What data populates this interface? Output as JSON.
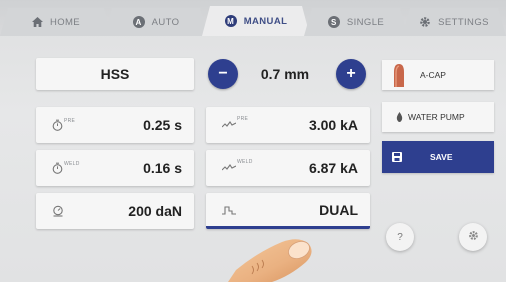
{
  "tabs": [
    {
      "label": "HOME",
      "icon": "home-icon",
      "active": false
    },
    {
      "label": "AUTO",
      "icon": "auto-icon",
      "active": false
    },
    {
      "label": "MANUAL",
      "icon": "manual-icon",
      "active": true
    },
    {
      "label": "SINGLE",
      "icon": "single-icon",
      "active": false
    },
    {
      "label": "SETTINGS",
      "icon": "gear-icon",
      "active": false
    }
  ],
  "material": {
    "value": "HSS"
  },
  "thickness": {
    "value": "0.7 mm",
    "minus": "−",
    "plus": "+"
  },
  "pre_time": {
    "sup": "PRE",
    "value": "0.25 s"
  },
  "weld_time": {
    "sup": "WELD",
    "value": "0.16 s"
  },
  "force": {
    "value": "200 daN"
  },
  "pre_current": {
    "sup": "PRE",
    "value": "3.00 kA"
  },
  "weld_current": {
    "sup": "WELD",
    "value": "6.87 kA"
  },
  "mode": {
    "value": "DUAL"
  },
  "side": {
    "acap": "A-CAP",
    "water_pump": "WATER PUMP",
    "save": "SAVE"
  },
  "help": {
    "label": "?"
  },
  "colors": {
    "accent": "#2e3f8f",
    "underline": "#2e3f8f"
  }
}
